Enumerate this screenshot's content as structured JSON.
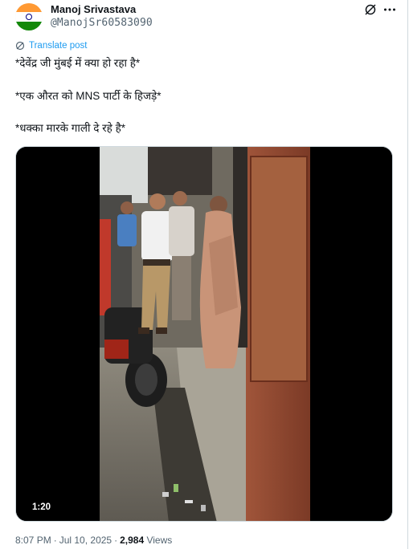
{
  "post": {
    "author": {
      "display_name": "Manoj Srivastava",
      "handle": "@ManojSr60583090",
      "avatar_icon": "indian-flag-avatar"
    },
    "header_actions": {
      "grok_icon": "grok-icon",
      "more_icon": "more-horizontal-icon"
    },
    "translate_label": "Translate post",
    "text_lines": [
      "*देवेंद्र जी मुंबई में क्या हो रहा है*",
      "*एक औरत को MNS पार्टी के हिजड़े*",
      "*धक्का मारके गाली दे रहे है*"
    ],
    "video": {
      "duration": "1:20"
    },
    "meta": {
      "time": "8:07 PM",
      "date": "Jul 10, 2025",
      "views_count": "2,984",
      "views_label": "Views"
    }
  },
  "colors": {
    "accent": "#1d9bf0",
    "secondary_text": "#536471",
    "primary_text": "#0f1419"
  }
}
